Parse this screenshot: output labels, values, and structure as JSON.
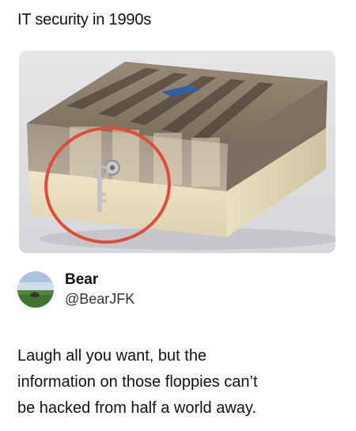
{
  "post": {
    "caption": "IT security in 1990s"
  },
  "photo": {
    "subject": "floppy disk storage box with lock and key",
    "highlight_color": "#e24a3b"
  },
  "user": {
    "display_name": "Bear",
    "handle": "@BearJFK"
  },
  "tweet": {
    "lines": [
      "Laugh all you want, but the",
      "information on those floppies can’t",
      "be hacked from half a world away."
    ]
  }
}
